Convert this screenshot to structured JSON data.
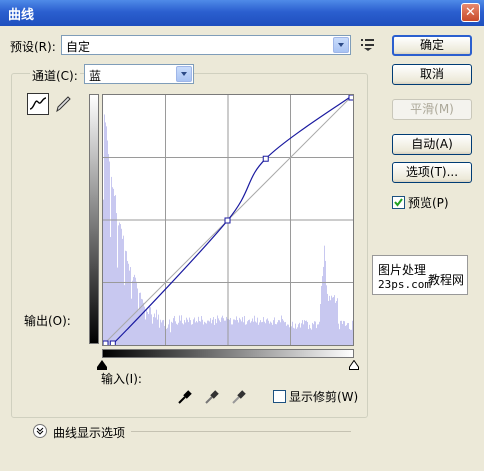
{
  "title": "曲线",
  "close_symbol": "✕",
  "preset": {
    "label": "预设(R):",
    "value": "自定"
  },
  "channel": {
    "label": "通道(C):",
    "value": "蓝"
  },
  "buttons": {
    "ok": "确定",
    "cancel": "取消",
    "smooth": "平滑(M)",
    "auto": "自动(A)",
    "options": "选项(T)..."
  },
  "preview": {
    "label": "预览(P)",
    "checked": true
  },
  "output_label": "输出(O):",
  "input_label": "输入(I):",
  "show_clipping": {
    "label": "显示修剪(W)",
    "checked": false
  },
  "curve_display_options": "曲线显示选项",
  "watermark": {
    "line1": "图片处理",
    "line2": "教程网",
    "site": "23ps.com"
  },
  "curve_points": [
    [
      0,
      0
    ],
    [
      10,
      1
    ],
    [
      127,
      127
    ],
    [
      166,
      190
    ],
    [
      255,
      255
    ]
  ],
  "colors": {
    "curve": "#1a1aa0",
    "histogram": "#c8c8f0",
    "title_bar": "#2b5fcf"
  }
}
